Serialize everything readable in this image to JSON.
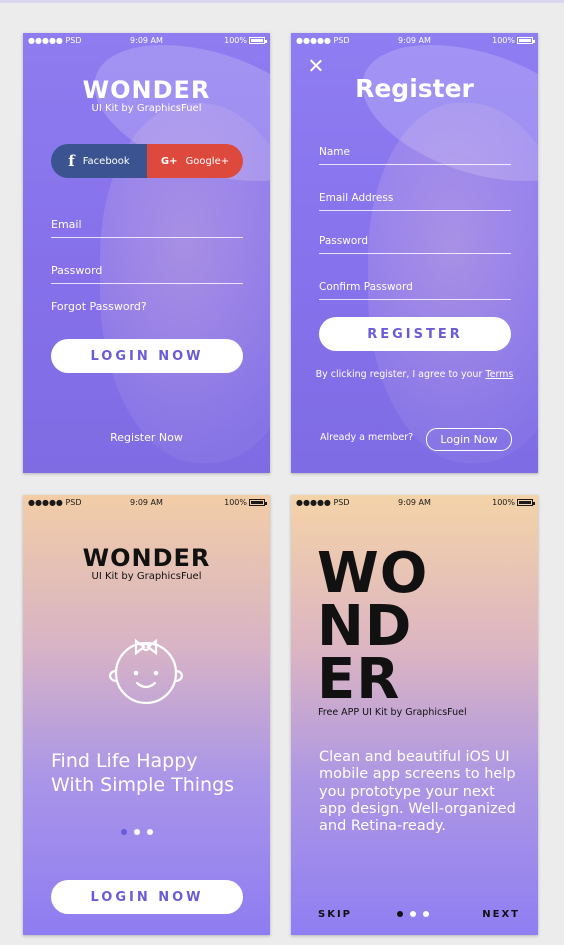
{
  "status": {
    "carrier": "●●●●● PSD",
    "time": "9:09 AM",
    "battery": "100%"
  },
  "login": {
    "title": "WONDER",
    "subtitle": "UI Kit by GraphicsFuel",
    "facebook_label": "Facebook",
    "facebook_icon": "f",
    "google_label": "Google+",
    "google_icon": "G+",
    "email_label": "Email",
    "password_label": "Password",
    "forgot_label": "Forgot Password?",
    "login_button": "LOGIN NOW",
    "register_link": "Register Now"
  },
  "register": {
    "title": "Register",
    "fields": [
      "Name",
      "Email Address",
      "Password",
      "Confirm Password"
    ],
    "register_button": "REGISTER",
    "terms_text": "By clicking register, I agree to your",
    "terms_link": "Terms",
    "member_text": "Already a member?",
    "login_button": "Login Now"
  },
  "welcome": {
    "title": "WONDER",
    "subtitle": "UI Kit by GraphicsFuel",
    "icon": "baby-face-icon",
    "tagline_line1": "Find Life Happy",
    "tagline_line2": "With Simple Things",
    "login_button": "LOGIN NOW"
  },
  "intro": {
    "big_line1": "WO",
    "big_line2": "ND",
    "big_line3": "ER",
    "subtitle": "Free APP UI Kit by GraphicsFuel",
    "description": "Clean and beautiful iOS UI mobile app screens to help you prototype your next app design. Well-organized and Retina-ready.",
    "skip_label": "SKIP",
    "next_label": "NEXT"
  },
  "colors": {
    "accent": "#6a5bd6",
    "facebook": "#3b5491",
    "google": "#dd4a3d"
  }
}
